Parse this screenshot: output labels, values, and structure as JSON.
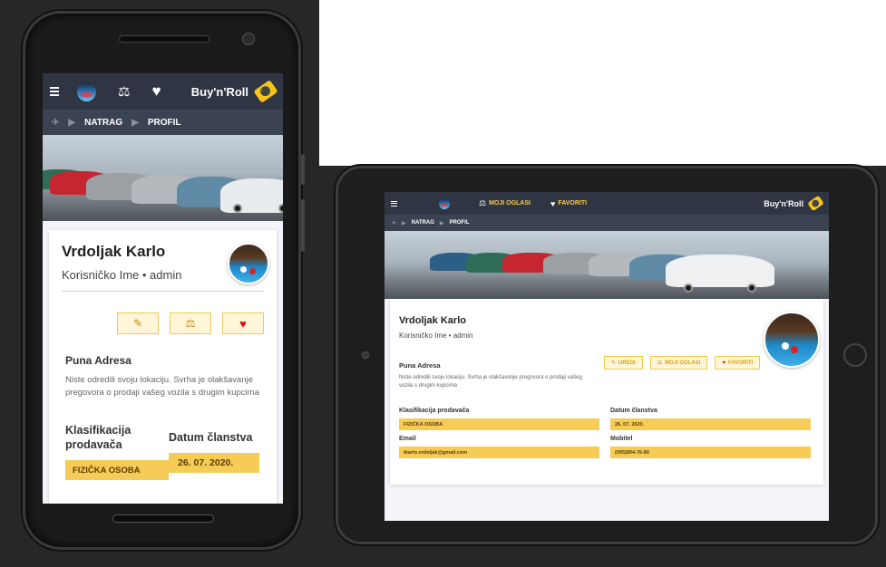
{
  "brand": "Buy'n'Roll",
  "nav": {
    "my_ads": "MOJI OGLASI",
    "favorites": "FAVORITI"
  },
  "breadcrumb": {
    "back": "NATRAG",
    "profile": "PROFIL"
  },
  "profile": {
    "name": "Vrdoljak Karlo",
    "username_line": "Korisničko Ime • admin",
    "address_title": "Puna Adresa",
    "address_text": "Niste odredili svoju lokaciju. Svrha je olakšavanje pregovora o prodaji vašeg vozila s drugim kupcima",
    "seller_class_label": "Klasifikacija prodavača",
    "seller_class_label_l1": "Klasifikacija",
    "seller_class_label_l2": "prodavača",
    "seller_class_value": "FIZIČKA OSOBA",
    "member_since_label": "Datum članstva",
    "member_since_value": "26. 07. 2020.",
    "email_label": "Email",
    "email_value": "tkarlo.vrdoljak@gmail.com",
    "phone_label": "Mobitel",
    "phone_value": "(095)894-76-80"
  },
  "actions": {
    "edit": "UREDI",
    "ads": "MOJI OGLASI",
    "fav": "FAVORITI"
  },
  "icons": {
    "menu": "hamburger-icon",
    "avatar": "avatar",
    "ads": "ads-icon",
    "heart": "heart-icon",
    "tag": "price-tag-icon",
    "car": "car-icon",
    "chevron": "triangle-right-icon",
    "edit": "user-edit-icon"
  },
  "colors": {
    "navbar": "#2f3542",
    "crumbs": "#3b4252",
    "accent": "#f6cc56",
    "heart": "#d11"
  }
}
